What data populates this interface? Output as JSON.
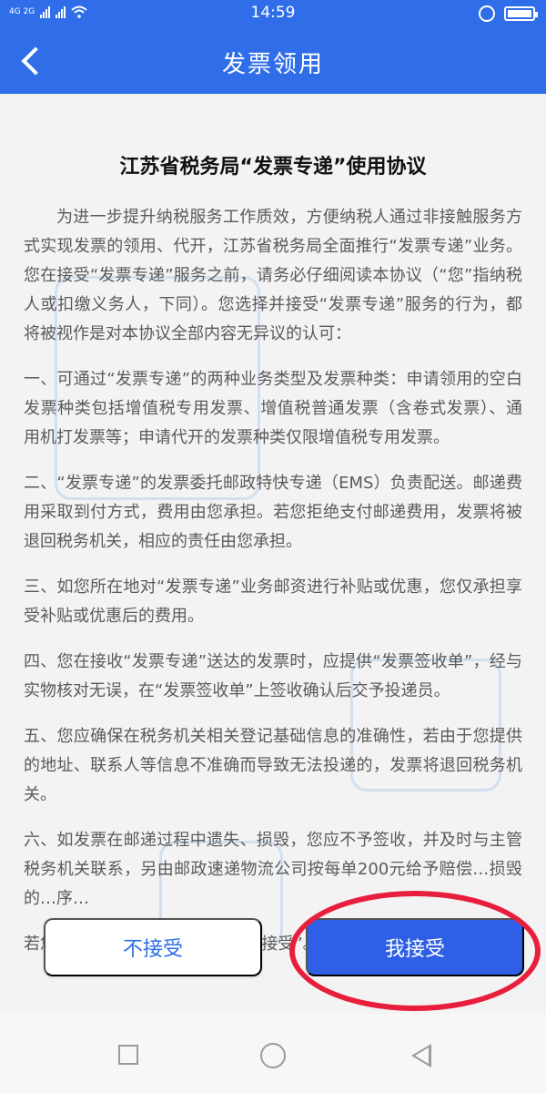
{
  "status_bar": {
    "network": "4G 2G",
    "time": "14:59"
  },
  "header": {
    "title": "发票领用"
  },
  "document": {
    "title": "江苏省税务局“发票专递”使用协议",
    "paragraphs": [
      "为进一步提升纳税服务工作质效，方便纳税人通过非接触服务方式实现发票的领用、代开，江苏省税务局全面推行“发票专递”业务。您在接受“发票专递”服务之前，请务必仔细阅读本协议（“您”指纳税人或扣缴义务人，下同）。您选择并接受“发票专递”服务的行为，都将被视作是对本协议全部内容无异议的认可：",
      "一、可通过“发票专递”的两种业务类型及发票种类：申请领用的空白发票种类包括增值税专用发票、增值税普通发票（含卷式发票）、通用机打发票等；申请代开的发票种类仅限增值税专用发票。",
      "二、“发票专递”的发票委托邮政特快专递（EMS）负责配送。邮递费用采取到付方式，费用由您承担。若您拒绝支付邮递费用，发票将被退回税务机关，相应的责任由您承担。",
      "三、如您所在地对“发票专递”业务邮资进行补贴或优惠，您仅承担享受补贴或优惠后的费用。",
      "四、您在接收“发票专递”送达的发票时，应提供“发票签收单”，经与实物核对无误，在“发票签收单”上签收确认后交予投递员。",
      "五、您应确保在税务机关相关登记基础信息的准确性，若由于您提供的地址、联系人等信息不准确而导致无法投递的，发票将退回税务机关。",
      "六、如发票在邮递过程中遗失、损毁，您应不予签收，并及时与主管税务机关联系，另由邮政速递物流公司按每单200元给予赔偿…损毁的…序…",
      "若您同意接受本协议，请点击“我接受”。如果您不同意本协议的条"
    ]
  },
  "buttons": {
    "reject": "不接受",
    "accept": "我接受"
  },
  "colors": {
    "header_blue": "#2f6ee8",
    "accept_blue": "#2f5fe6",
    "highlight_red": "#e81f3c"
  }
}
